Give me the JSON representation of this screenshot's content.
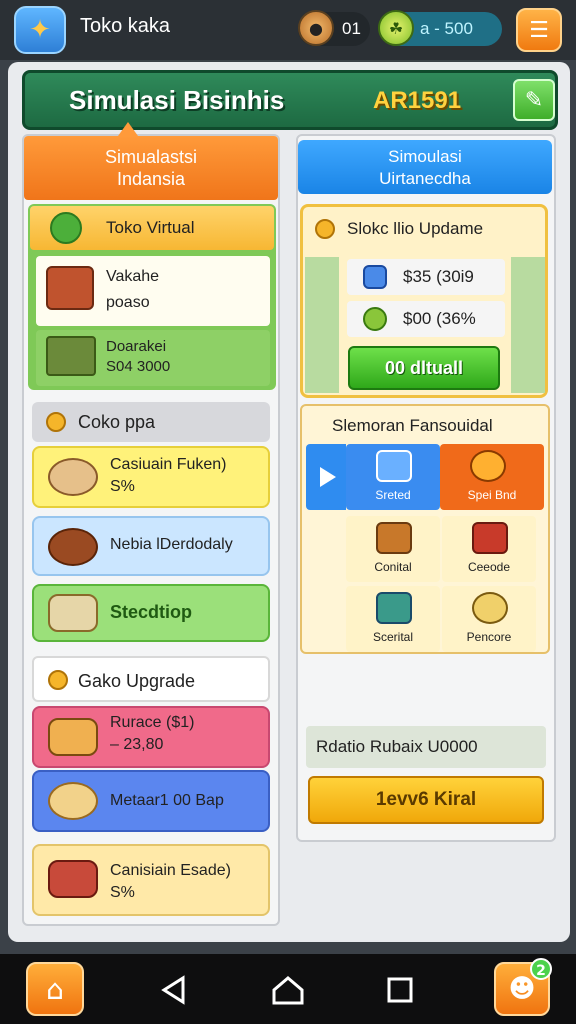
{
  "topbar": {
    "app_title": "Toko kaka",
    "resource1_value": "01",
    "resource2_value": "a - 500",
    "app_icon": "bird-icon",
    "resource1_icon": "bowl-icon",
    "resource2_icon": "leaf-coin-icon",
    "menu_icon": "menu-icon"
  },
  "header": {
    "title": "Simulasi Bisinhis",
    "code": "AR1591",
    "edit_icon": "pencil-icon"
  },
  "left": {
    "tab_line1": "Simualastsi",
    "tab_line2": "Indansia",
    "toko_title": "Toko Virtual",
    "card1_line1": "Vakahe",
    "card1_line2": "poaso",
    "card2_line1": "Doarakei",
    "card2_line2": "S04 3000",
    "coko_title": "Coko ppa",
    "item1_line1": "Casiuain Fuken)",
    "item1_line2": "S%",
    "item2_line1": "Nebia lDerdodaly",
    "item3_line1": "Stecdtiop",
    "gako_title": "Gako Upgrade",
    "item4_line1": "Rurace ($1)",
    "item4_line2": "– 23,80",
    "item5_line1": "Metaar1 00 Bap",
    "item6_line1": "Canisiain Esade)",
    "item6_line2": "S%"
  },
  "right": {
    "tab_line1": "Simoulasi",
    "tab_line2": "Uirtanecdha",
    "upgrade_title": "Slokc llio Updame",
    "row1_text": "$35 (30i9",
    "row2_text": "$00 (36%",
    "green_button": "00 dltuall",
    "slem_title": "Slemoran Fansouidal",
    "cells": [
      {
        "label": "Sreted",
        "icon": "calendar-icon"
      },
      {
        "label": "Spei Bnd",
        "icon": "swirl-icon"
      },
      {
        "label": "Conital",
        "icon": "cake-icon"
      },
      {
        "label": "Ceeode",
        "icon": "box-icon"
      },
      {
        "label": "Scerital",
        "icon": "photo-icon"
      },
      {
        "label": "Pencore",
        "icon": "brush-icon"
      }
    ],
    "footer_text": "Rdatio Rubaix U0000",
    "yellow_button": "1evv6 Kiral"
  },
  "nav": {
    "badge": "2"
  },
  "colors": {
    "header_green": "#1d6a42",
    "accent_orange": "#f0751a",
    "accent_blue": "#1a84e6",
    "gold": "#ffd23f"
  }
}
